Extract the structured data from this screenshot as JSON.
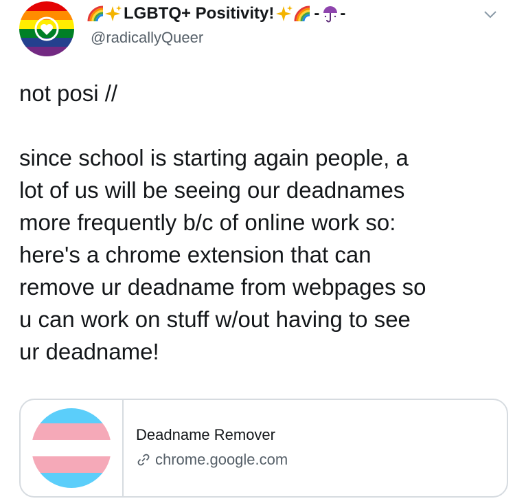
{
  "author": {
    "display_name": "LGBTQ+ Positivity!",
    "handle": "@radicallyQueer",
    "name_emojis": [
      "rainbow",
      "sparkles",
      "sparkles",
      "rainbow",
      "umbrella"
    ],
    "name_separators": [
      "-",
      "-"
    ]
  },
  "tweet": {
    "text": "not posi //\n\nsince school is starting again people, a\nlot of us will be seeing our deadnames\nmore frequently b/c of online work so:\nhere's a chrome extension that can\nremove ur deadname from webpages so\nu can work on stuff w/out having to see\nur deadname!"
  },
  "link_card": {
    "title": "Deadname Remover",
    "domain": "chrome.google.com",
    "thumbnail_colors": [
      "#5bcefa",
      "#f5a9b8",
      "#ffffff",
      "#f5a9b8",
      "#5bcefa"
    ]
  },
  "icons": {
    "caret": "chevron-down-icon",
    "link": "link-icon"
  },
  "colors": {
    "text": "#14171a",
    "secondary": "#555f68",
    "border": "#d6dbe0"
  }
}
